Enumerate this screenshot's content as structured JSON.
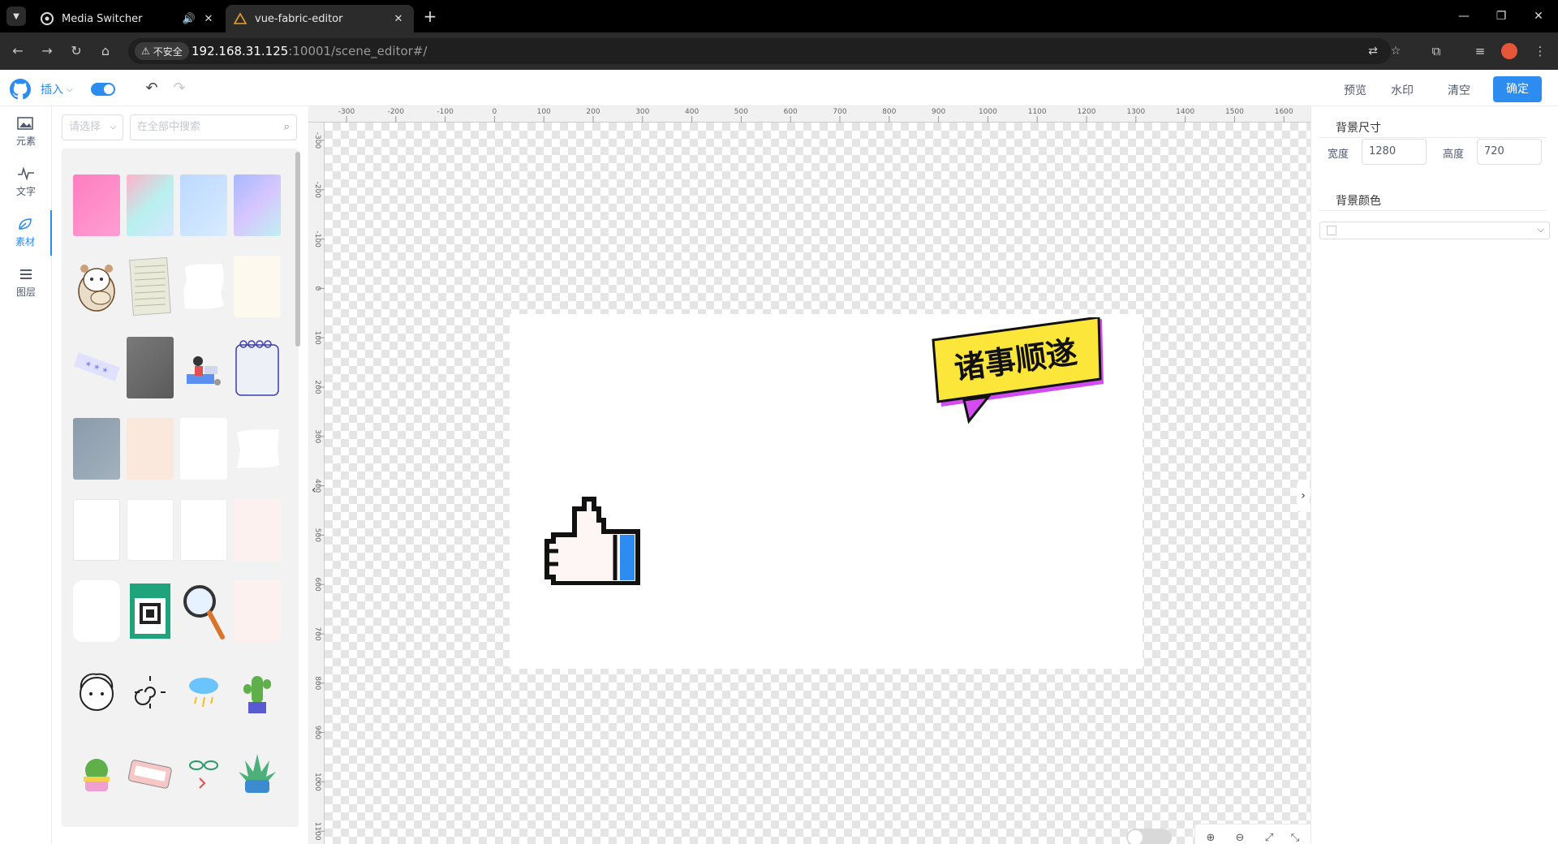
{
  "browser": {
    "tabs": [
      {
        "title": "Media Switcher",
        "active": false
      },
      {
        "title": "vue-fabric-editor",
        "active": true
      }
    ],
    "security_label": "不安全",
    "url_host": "192.168.31.125",
    "url_rest": ":10001/scene_editor#/"
  },
  "header": {
    "insert_label": "插入",
    "preview_label": "预览",
    "watermark_label": "水印",
    "clear_label": "清空",
    "confirm_label": "确定"
  },
  "rail": {
    "items": [
      {
        "label": "元素",
        "icon": "image-icon"
      },
      {
        "label": "文字",
        "icon": "pulse-icon"
      },
      {
        "label": "素材",
        "icon": "leaf-icon",
        "active": true
      },
      {
        "label": "图层",
        "icon": "layers-icon"
      }
    ]
  },
  "panel": {
    "select_placeholder": "请选择",
    "search_placeholder": "在全部中搜索"
  },
  "ruler": {
    "top_labels": [
      "-300",
      "-200",
      "-100",
      "0",
      "100",
      "200",
      "300",
      "400",
      "500",
      "600",
      "700",
      "800",
      "900",
      "1000",
      "1100",
      "1200",
      "1300",
      "1400",
      "1500",
      "1600"
    ],
    "left_labels": [
      "-300",
      "-200",
      "-100",
      "0",
      "100",
      "200",
      "300",
      "400",
      "500",
      "600",
      "700",
      "800",
      "900",
      "1000",
      "1100"
    ]
  },
  "canvas": {
    "banner_text": "诸事顺遂"
  },
  "props": {
    "size_title": "背景尺寸",
    "width_label": "宽度",
    "width_value": "1280",
    "height_label": "高度",
    "height_value": "720",
    "color_title": "背景颜色"
  },
  "colors": {
    "accent": "#2d8cf0",
    "banner_yellow": "#fde63a",
    "banner_purple": "#d44cf0"
  }
}
